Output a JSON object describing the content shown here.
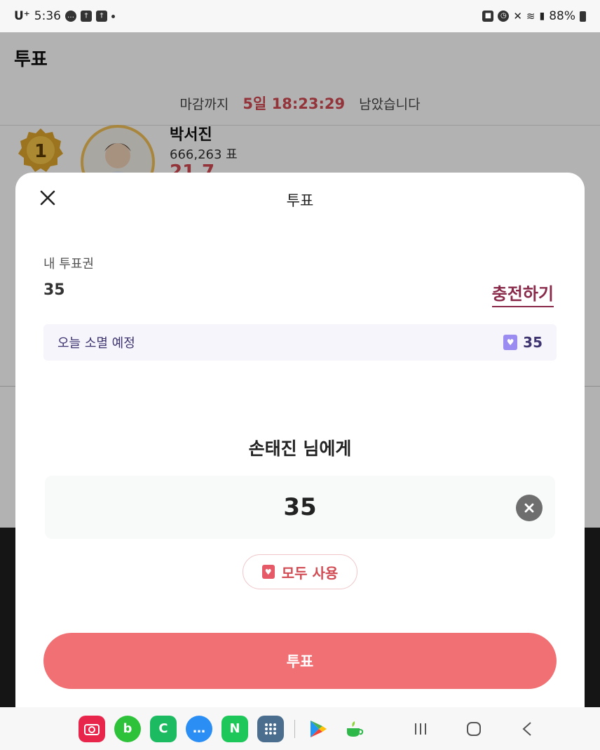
{
  "status_bar": {
    "carrier": "U⁺",
    "time": "5:36",
    "battery": "88%"
  },
  "page": {
    "title": "투표",
    "deadline_prefix": "마감까지",
    "deadline_time": "5일 18:23:29",
    "deadline_suffix": "남았습니다",
    "candidate": {
      "rank": "1",
      "name": "박서진",
      "votes": "666,263 표",
      "percent": "21.7"
    }
  },
  "sheet": {
    "title": "투표",
    "my_tickets_label": "내 투표권",
    "my_tickets_count": "35",
    "charge_label": "충전하기",
    "expire_label": "오늘 소멸 예정",
    "expire_count": "35",
    "recipient": "손태진 님에게",
    "amount_value": "35",
    "use_all_label": "모두 사용",
    "vote_button_label": "투표"
  },
  "colors": {
    "accent": "#d24b53",
    "vote_button": "#f07074",
    "charge": "#8a2a4a",
    "expire_text": "#3d3470",
    "purple_ticket": "#9a8cf0"
  },
  "icons": {
    "close": "close-icon",
    "clear": "clear-icon",
    "ticket": "ticket-heart-icon"
  },
  "navbar": {
    "apps": [
      {
        "name": "camera-app",
        "color": "#e8254b"
      },
      {
        "name": "band-app",
        "color": "#2ec23a"
      },
      {
        "name": "phone-app",
        "color": "#1dbb61"
      },
      {
        "name": "messages-app",
        "color": "#2b8ef5"
      },
      {
        "name": "naver-app",
        "color": "#1ec759"
      },
      {
        "name": "app-drawer",
        "color": "#4c6e8e"
      },
      {
        "name": "play-store-app",
        "color": "#ffffff"
      },
      {
        "name": "tea-app",
        "color": "#ffffff"
      }
    ]
  }
}
